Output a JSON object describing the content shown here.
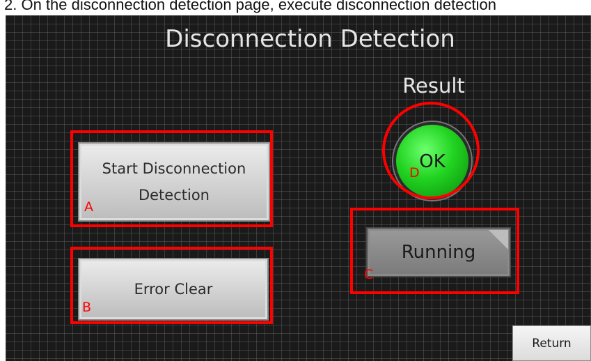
{
  "caption": "2. On the disconnection detection page, execute disconnection detection",
  "screen": {
    "title": "Disconnection Detection",
    "result_label": "Result",
    "result_lamp": {
      "text": "OK",
      "state": "ok",
      "color": "#21d321"
    },
    "buttons": {
      "start_detection": "Start Disconnection\nDetection",
      "error_clear": "Error Clear",
      "running": "Running",
      "return": "Return"
    }
  },
  "annotations": {
    "color": "#ff0000",
    "labels": {
      "a": "A",
      "b": "B",
      "c": "C",
      "d": "D"
    }
  }
}
